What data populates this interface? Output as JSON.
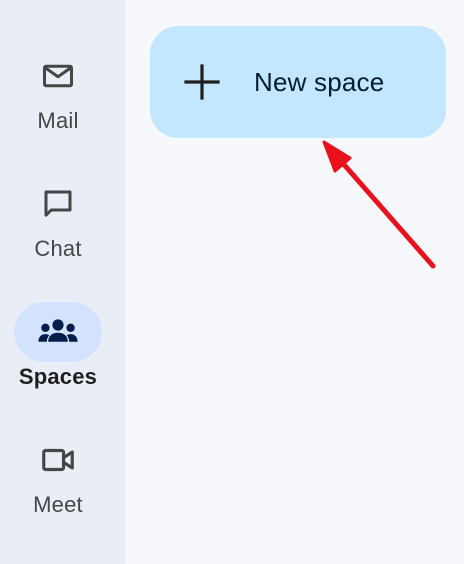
{
  "nav_rail": {
    "items": [
      {
        "label": "Mail",
        "icon": "mail-icon",
        "active": false
      },
      {
        "label": "Chat",
        "icon": "chat-icon",
        "active": false
      },
      {
        "label": "Spaces",
        "icon": "spaces-icon",
        "active": true
      },
      {
        "label": "Meet",
        "icon": "meet-icon",
        "active": false
      }
    ]
  },
  "main": {
    "new_space_button": {
      "label": "New space",
      "icon": "plus-icon"
    }
  },
  "annotation": {
    "type": "arrow",
    "color": "#e8111c",
    "points_to": "new-space-button"
  },
  "colors": {
    "rail_background": "#e9eef6",
    "main_background": "#f6f8fc",
    "active_pill": "#d3e3fd",
    "new_space_button": "#c2e7ff",
    "active_icon": "#041e49"
  }
}
